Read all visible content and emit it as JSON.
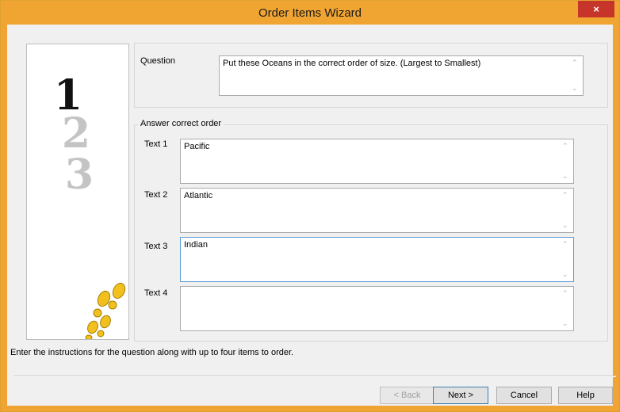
{
  "window": {
    "title": "Order Items Wizard",
    "close_glyph": "×"
  },
  "question": {
    "label": "Question",
    "value": "Put these Oceans in the correct order of size. (Largest to Smallest)"
  },
  "answers": {
    "group_label": "Answer correct order",
    "items": [
      {
        "label": "Text 1",
        "value": "Pacific"
      },
      {
        "label": "Text 2",
        "value": "Atlantic"
      },
      {
        "label": "Text 3",
        "value": "Indian"
      },
      {
        "label": "Text 4",
        "value": ""
      }
    ]
  },
  "illustration": {
    "digits": [
      "1",
      "2",
      "3"
    ],
    "icon": "footsteps-icon"
  },
  "instructions": "Enter the instructions for the question along with up to four items to order.",
  "buttons": {
    "back": "< Back",
    "next": "Next >",
    "cancel": "Cancel",
    "help": "Help"
  },
  "colors": {
    "titlebar": "#f0a532",
    "close": "#c7352a",
    "footprints": "#f2c01e"
  }
}
